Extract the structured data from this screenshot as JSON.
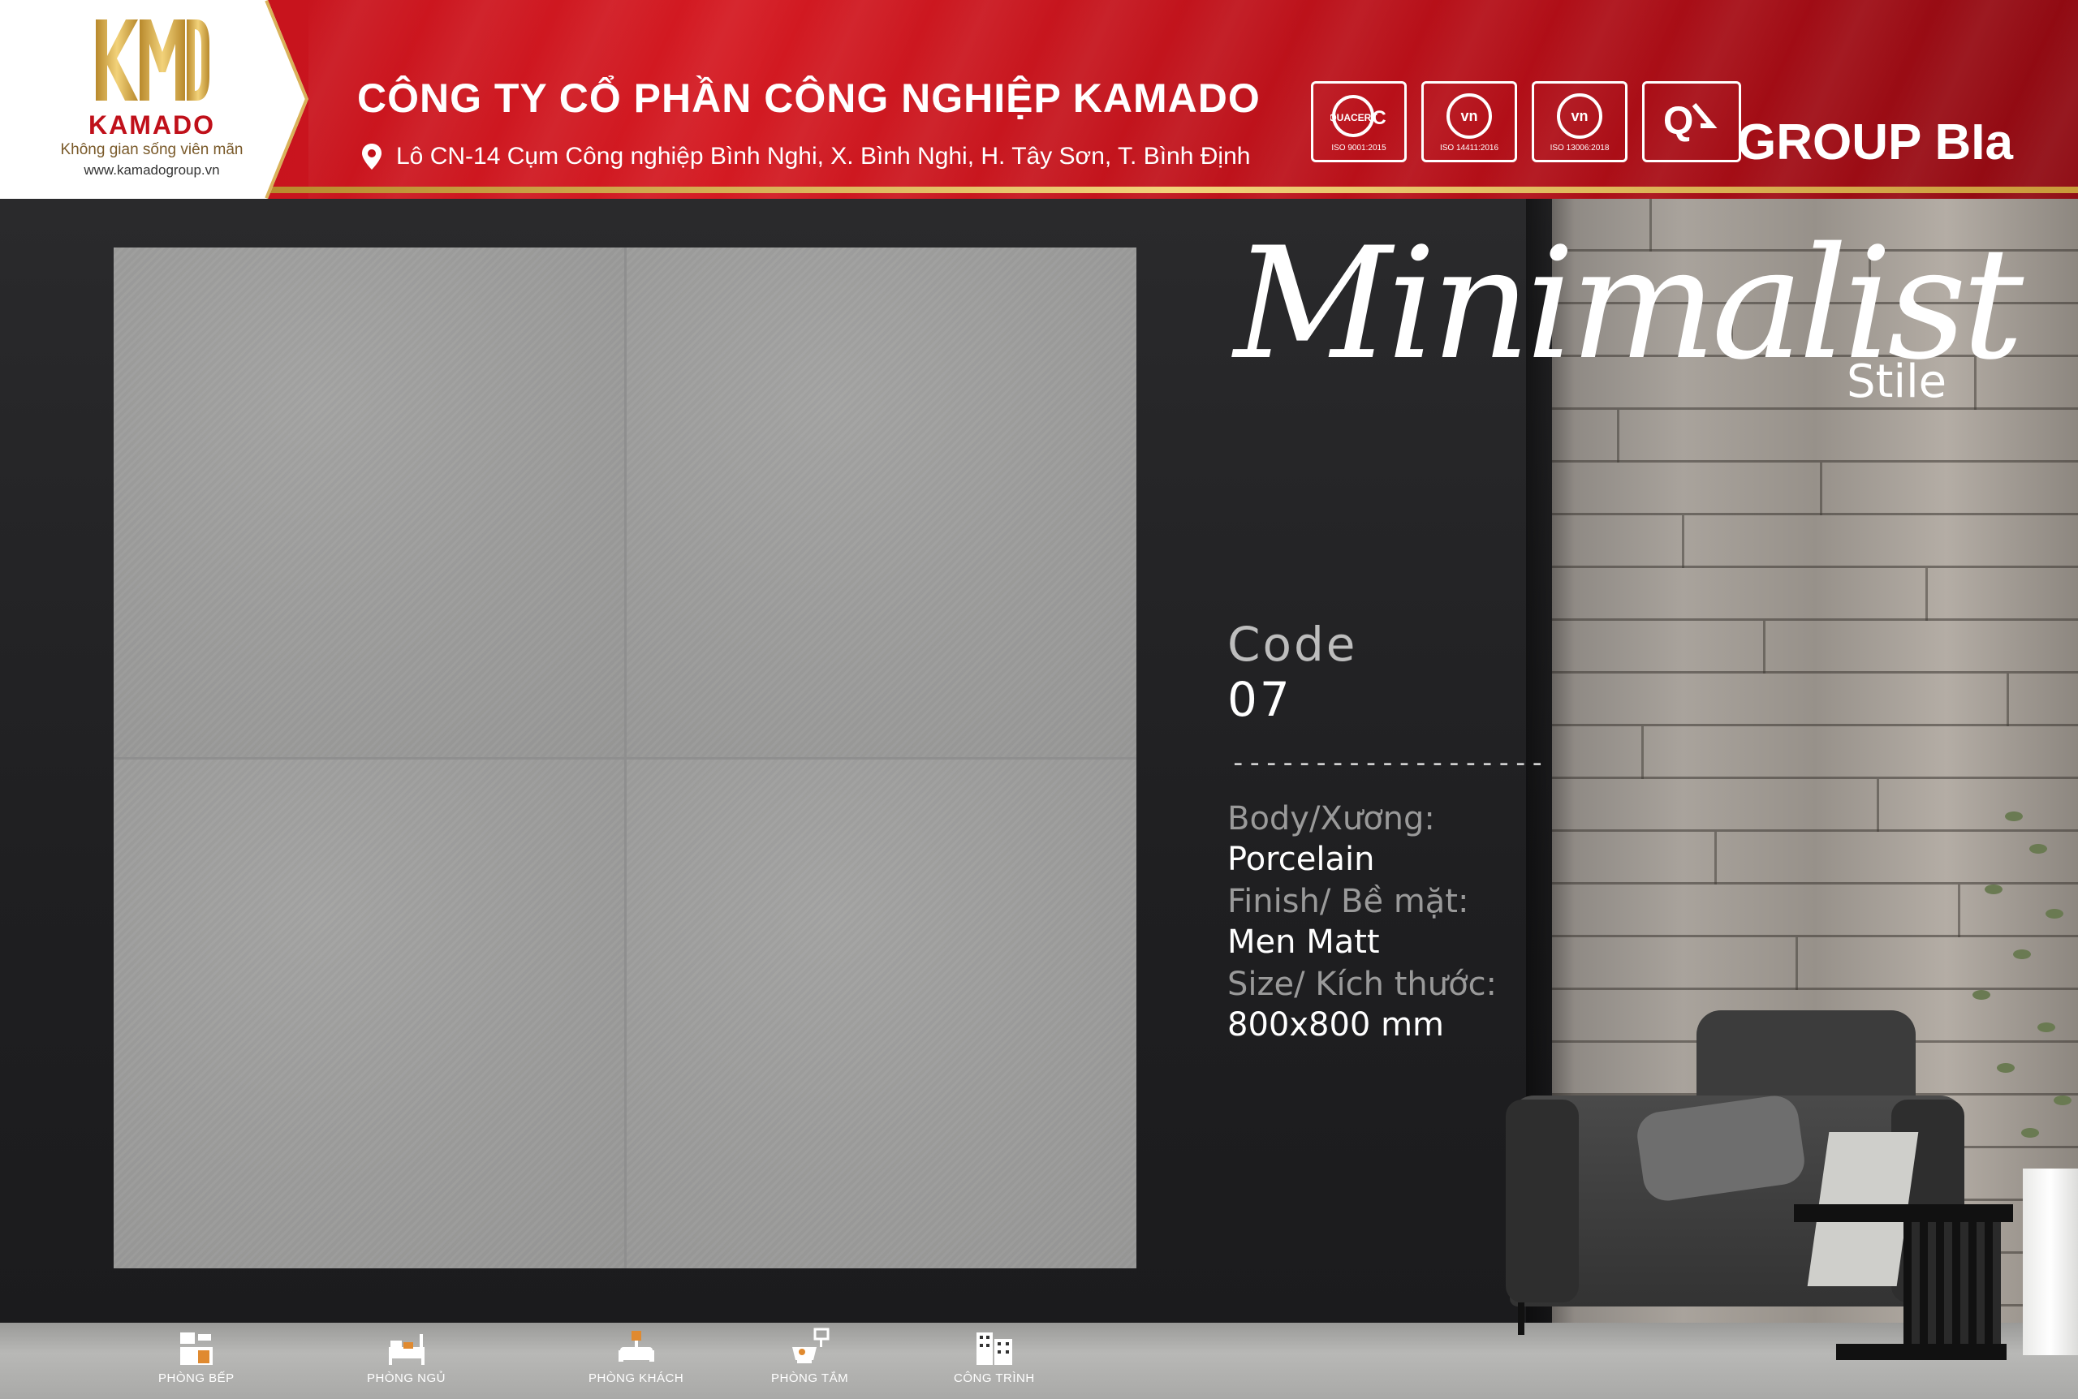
{
  "header": {
    "logo_name": "KAMADO",
    "logo_mark": "KMD",
    "slogan": "Không gian sống viên mãn",
    "website": "www.kamadogroup.vn",
    "company_name": "CÔNG TY CỔ PHẦN CÔNG NGHIỆP KAMADO",
    "address": "Lô CN-14 Cụm Công nghiệp Bình Nghi, X. Bình Nghi, H. Tây Sơn, T. Bình Định",
    "group": "GROUP BIa",
    "certifications": [
      {
        "icon": "quacert-iso9001-icon",
        "caption": "ISO 9001:2015"
      },
      {
        "icon": "quacert-iso14001-icon",
        "caption": "ISO 14411:2016"
      },
      {
        "icon": "quacert-iso13006-icon",
        "caption": "ISO 13006:2018"
      },
      {
        "icon": "quacert-cr-icon",
        "caption": "QUACERT"
      }
    ]
  },
  "product": {
    "title_script": "Minimalist",
    "title_suffix": "Stile",
    "code_label": "Code",
    "code_value": "07",
    "divider": "-------------------",
    "specs": [
      {
        "label": "Body/Xương:",
        "value": "Porcelain"
      },
      {
        "label": "Finish/ Bề mặt:",
        "value": "Men Matt"
      },
      {
        "label": "Size/ Kích thước:",
        "value": "800x800 mm"
      }
    ]
  },
  "rooms": [
    {
      "label": "PHÒNG BẾP",
      "icon": "kitchen-icon"
    },
    {
      "label": "PHÒNG NGỦ",
      "icon": "bedroom-icon"
    },
    {
      "label": "PHÒNG KHÁCH",
      "icon": "living-room-icon"
    },
    {
      "label": "PHÒNG TẮM",
      "icon": "bathroom-icon"
    },
    {
      "label": "CÔNG TRÌNH",
      "icon": "building-icon"
    }
  ],
  "colors": {
    "brand_red": "#c0101a",
    "gold": "#d9b25a",
    "tile_gray": "#9d9d9c",
    "background_dark": "#1f1f21"
  }
}
